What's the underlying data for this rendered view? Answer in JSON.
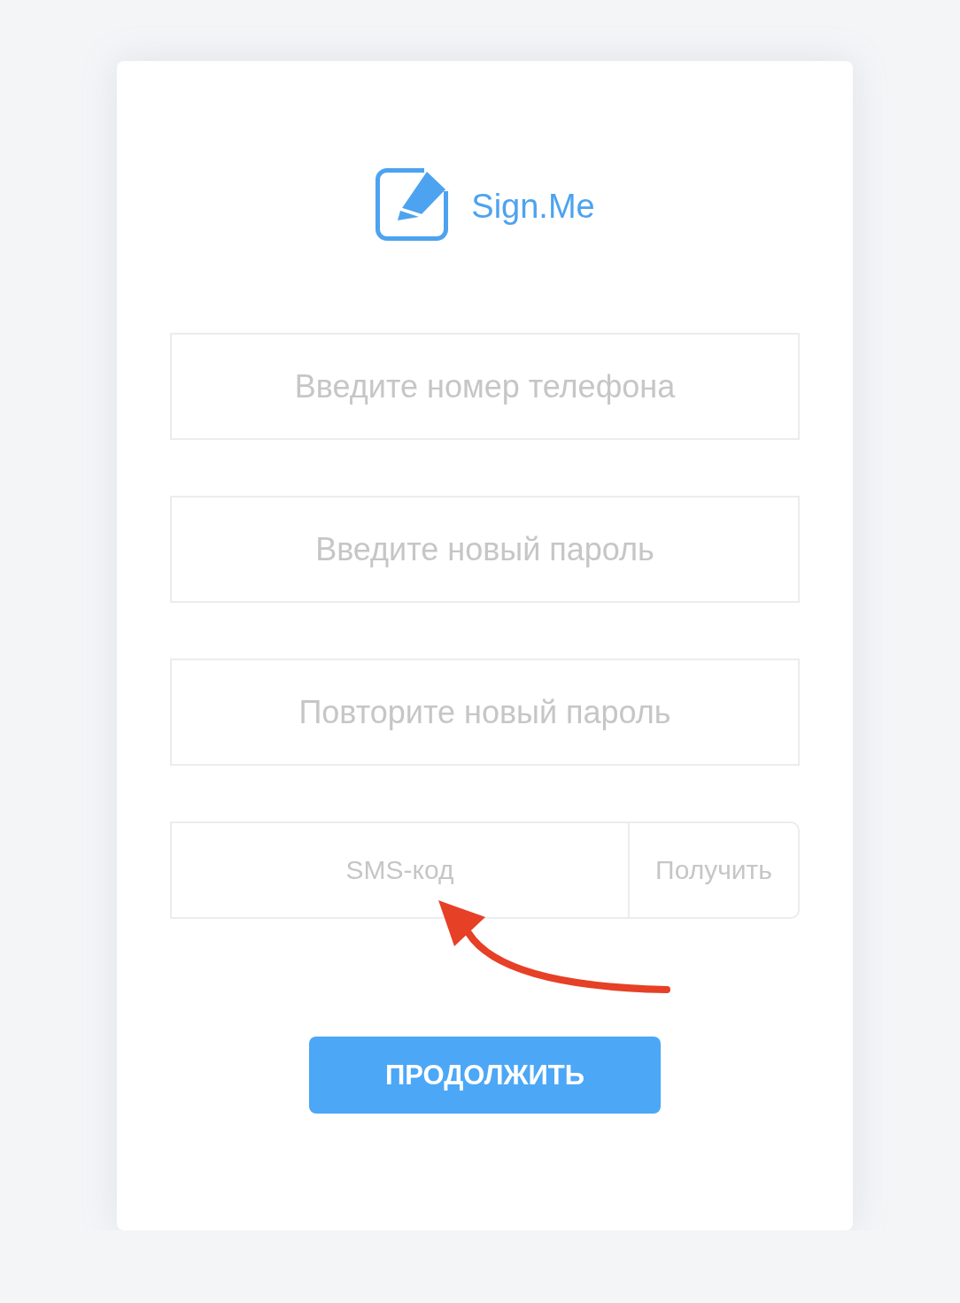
{
  "logo": {
    "text": "Sign.Me"
  },
  "fields": [
    {
      "placeholder": "Введите номер телефона"
    },
    {
      "placeholder": "Введите новый пароль"
    },
    {
      "placeholder": "Повторите новый пароль"
    }
  ],
  "sms": {
    "placeholder": "SMS-код",
    "button": "Получить"
  },
  "submit": {
    "label": "ПРОДОЛЖИТЬ"
  }
}
